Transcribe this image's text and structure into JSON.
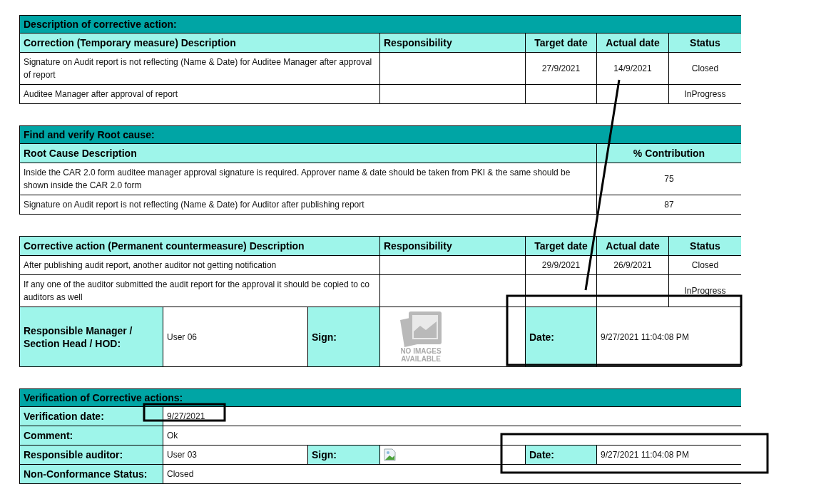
{
  "sections": [
    {
      "kind": "action",
      "title": "Description of corrective action:",
      "columns": [
        "Correction (Temporary measure) Description",
        "Responsibility",
        "Target date",
        "Actual date",
        "Status"
      ],
      "rows": [
        {
          "description": "Signature on Audit report is not reflecting (Name & Date) for Auditee Manager after approval of report",
          "target_date": "27/9/2021",
          "actual_date": "14/9/2021",
          "status": "Closed"
        },
        {
          "description": "Auditee Manager after approval of report",
          "status": "InProgress"
        }
      ]
    },
    {
      "kind": "root_cause",
      "title": "Find and verify Root cause:",
      "columns": [
        "Root Cause Description",
        "% Contribution"
      ],
      "rows": [
        {
          "description": "Inside the CAR 2.0 form auditee manager approval signature is required. Approver name & date should be taken from PKI & the same should be shown inside the CAR 2.0 form",
          "contribution": "75"
        },
        {
          "description": "Signature on Audit report is not reflecting (Name & Date) for Auditor after publishing report",
          "contribution": "87"
        }
      ]
    },
    {
      "kind": "action",
      "columns": [
        "Corrective action (Permanent countermeasure) Description",
        "Responsibility",
        "Target date",
        "Actual date",
        "Status"
      ],
      "rows": [
        {
          "description": "After publishing audit report, another auditor not getting notification",
          "target_date": "29/9/2021",
          "actual_date": "26/9/2021",
          "status": "Closed"
        },
        {
          "description": "If any one of the auditor submitted the audit report for the approval it should be copied to co auditors as well",
          "status": "InProgress"
        }
      ],
      "sign_off": {
        "label": "Responsible Manager / Section Head / HOD:",
        "name": "User 06",
        "sign_label": "Sign:",
        "sign_image": {
          "kind": "placeholder",
          "caption": "NO IMAGES AVAILABLE"
        },
        "date_label": "Date:",
        "date": "9/27/2021 11:04:08 PM"
      }
    },
    {
      "kind": "verification",
      "title": "Verification of Corrective actions:",
      "rows": [
        {
          "kind": "field",
          "label": "Verification date:",
          "value": "9/27/2021"
        },
        {
          "kind": "field",
          "label": "Comment:",
          "value": "Ok"
        },
        {
          "kind": "sign_off",
          "label": "Responsible auditor:",
          "name": "User 03",
          "sign_label": "Sign:",
          "sign_image": {
            "kind": "broken"
          },
          "date_label": "Date:",
          "date": "9/27/2021 11:04:08 PM"
        },
        {
          "kind": "field",
          "label": "Non-Conformance Status:",
          "value": "Closed"
        }
      ]
    }
  ]
}
